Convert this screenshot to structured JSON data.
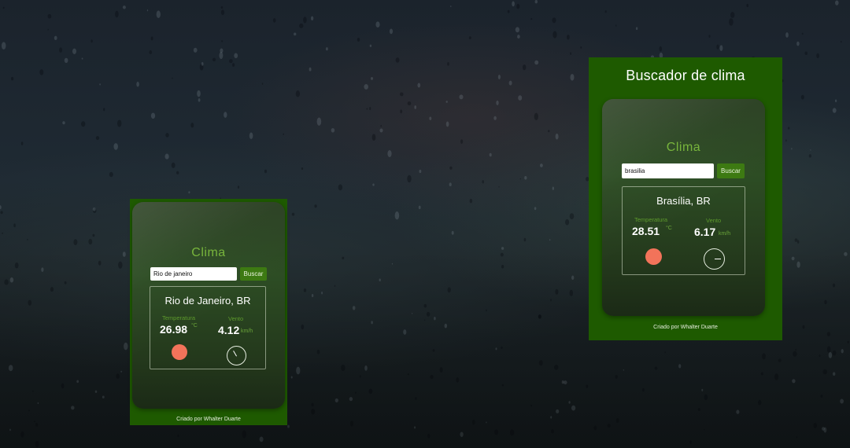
{
  "background": {
    "style": "rain-drops-on-glass",
    "base_color": "#1d262e"
  },
  "theme": {
    "card_green": "#1e5a00",
    "accent_green": "#78b53c",
    "button_green": "#3d7a12",
    "sun_color": "#f2735a"
  },
  "widgets": [
    {
      "app_title": "",
      "section_title": "Clima",
      "search_value": "Rio de janeiro",
      "search_button": "Buscar",
      "city": "Rio de Janeiro, BR",
      "temp_label": "Temperatura",
      "temp_value": "26.98",
      "temp_unit": "°C",
      "wind_label": "Vento",
      "wind_value": "4.12",
      "wind_unit": "km/h",
      "weather_icon": "sun-icon",
      "wind_icon": "wind-direction-gauge-icon",
      "wind_needle_deg": 150,
      "credit": "Criado por Whalter Duarte"
    },
    {
      "app_title": "Buscador de clima",
      "section_title": "Clima",
      "search_value": "brasilia",
      "search_button": "Buscar",
      "city": "Brasília, BR",
      "temp_label": "Temperatura",
      "temp_value": "28.51",
      "temp_unit": "°C",
      "wind_label": "Vento",
      "wind_value": "6.17",
      "wind_unit": "km/h",
      "weather_icon": "sun-icon",
      "wind_icon": "wind-direction-gauge-icon",
      "wind_needle_deg": 270,
      "credit": "Criado por Whalter Duarte"
    }
  ]
}
